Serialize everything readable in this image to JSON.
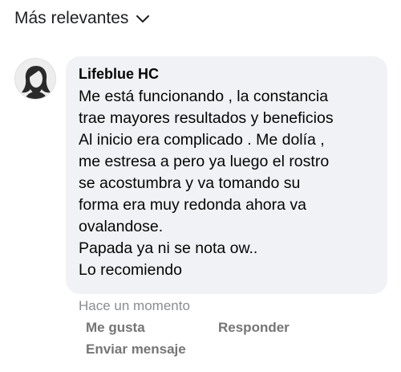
{
  "sort": {
    "label": "Más relevantes",
    "icon": "chevron-down-icon"
  },
  "comment": {
    "author": "Lifeblue HC",
    "avatar_icon": "woman-silhouette-avatar",
    "lines": [
      "Me está funcionando , la constancia",
      "trae mayores resultados y beneficios",
      "Al inicio era complicado . Me dolía ,",
      "me estresa a pero ya luego el rostro",
      "se acostumbra y va tomando su",
      "forma era muy redonda ahora va",
      "ovalandose.",
      "Papada ya ni se nota ow..",
      "Lo recomiendo"
    ],
    "timestamp": "Hace un momento",
    "actions": {
      "like": "Me gusta",
      "reply": "Responder",
      "message": "Enviar mensaje"
    }
  },
  "colors": {
    "bubble_bg": "#f0f2f5",
    "muted_text": "#8a8d91",
    "action_text": "#757575"
  }
}
